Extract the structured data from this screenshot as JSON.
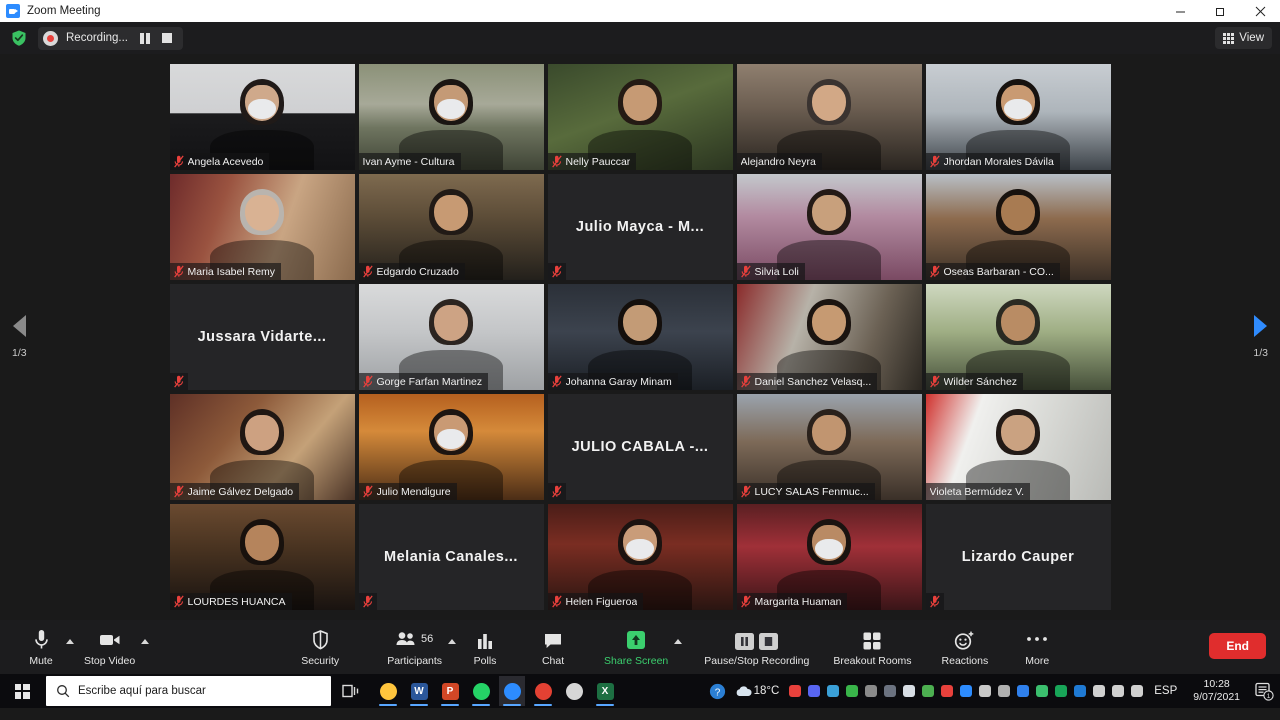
{
  "window": {
    "title": "Zoom Meeting",
    "app_icon": "zoom-icon",
    "minimize_label": "Minimize",
    "maximize_label": "Restore",
    "close_label": "Close"
  },
  "zoom_header": {
    "security_badge_icon": "shield-check-icon",
    "recording_label": "Recording...",
    "record_dot_icon": "record-dot-icon",
    "pause_icon": "pause-icon",
    "stop_icon": "stop-icon",
    "view_label": "View",
    "view_icon": "grid-view-icon"
  },
  "gallery": {
    "page_left_label": "1/3",
    "page_right_label": "1/3",
    "prev_icon": "chevron-left-icon",
    "next_icon": "chevron-right-icon",
    "mic_off_icon": "mic-muted-icon",
    "participants": [
      {
        "name": "Angela Acevedo",
        "muted": true,
        "speaking": false,
        "video": true,
        "display": "bar",
        "skin": "p1"
      },
      {
        "name": "Ivan Ayme - Cultura",
        "muted": false,
        "speaking": true,
        "video": true,
        "display": "bar",
        "skin": "p2"
      },
      {
        "name": "Nelly Pauccar",
        "muted": true,
        "speaking": false,
        "video": true,
        "display": "bar",
        "skin": "p3"
      },
      {
        "name": "Alejandro Neyra",
        "muted": false,
        "speaking": false,
        "video": true,
        "display": "bar",
        "skin": "p4"
      },
      {
        "name": "Jhordan Morales Dávila",
        "muted": true,
        "speaking": false,
        "video": true,
        "display": "bar",
        "skin": "p5"
      },
      {
        "name": "Maria Isabel Remy",
        "muted": true,
        "speaking": false,
        "video": true,
        "display": "bar",
        "skin": "p6"
      },
      {
        "name": "Edgardo Cruzado",
        "muted": true,
        "speaking": false,
        "video": true,
        "display": "bar",
        "skin": "p7"
      },
      {
        "name": "Julio Mayca - M...",
        "muted": true,
        "speaking": false,
        "video": false,
        "display": "center",
        "skin": "off"
      },
      {
        "name": "Silvia Loli",
        "muted": true,
        "speaking": false,
        "video": true,
        "display": "bar",
        "skin": "p8"
      },
      {
        "name": "Oseas Barbaran - CO...",
        "muted": true,
        "speaking": false,
        "video": true,
        "display": "bar",
        "skin": "p9"
      },
      {
        "name": "Jussara Vidarte...",
        "muted": true,
        "speaking": false,
        "video": false,
        "display": "center",
        "skin": "off"
      },
      {
        "name": "Gorge Farfan Martinez",
        "muted": true,
        "speaking": false,
        "video": true,
        "display": "bar",
        "skin": "p10"
      },
      {
        "name": "Johanna Garay Minam",
        "muted": true,
        "speaking": false,
        "video": true,
        "display": "bar",
        "skin": "p11"
      },
      {
        "name": "Daniel Sanchez Velasq...",
        "muted": true,
        "speaking": false,
        "video": true,
        "display": "bar",
        "skin": "p12"
      },
      {
        "name": "Wilder Sánchez",
        "muted": true,
        "speaking": false,
        "video": true,
        "display": "bar",
        "skin": "p13"
      },
      {
        "name": "Jaime Gálvez Delgado",
        "muted": true,
        "speaking": false,
        "video": true,
        "display": "bar",
        "skin": "p14"
      },
      {
        "name": "Julio Mendigure",
        "muted": true,
        "speaking": false,
        "video": true,
        "display": "bar",
        "skin": "p15"
      },
      {
        "name": "JULIO CABALA -...",
        "muted": true,
        "speaking": false,
        "video": false,
        "display": "center",
        "skin": "off"
      },
      {
        "name": "LUCY SALAS Fenmuc...",
        "muted": true,
        "speaking": false,
        "video": true,
        "display": "bar",
        "skin": "p16"
      },
      {
        "name": "Violeta Bermúdez V.",
        "muted": false,
        "speaking": false,
        "video": true,
        "display": "bar",
        "skin": "p17"
      },
      {
        "name": "LOURDES HUANCA",
        "muted": true,
        "speaking": false,
        "video": true,
        "display": "bar",
        "skin": "p18"
      },
      {
        "name": "Melania Canales...",
        "muted": true,
        "speaking": false,
        "video": false,
        "display": "center",
        "skin": "off"
      },
      {
        "name": "Helen Figueroa",
        "muted": true,
        "speaking": false,
        "video": true,
        "display": "bar",
        "skin": "p19"
      },
      {
        "name": "Margarita Huaman",
        "muted": true,
        "speaking": false,
        "video": true,
        "display": "bar",
        "skin": "p20"
      },
      {
        "name": "Lizardo Cauper",
        "muted": true,
        "speaking": false,
        "video": false,
        "display": "center",
        "skin": "off"
      }
    ]
  },
  "toolbar": {
    "mute_label": "Mute",
    "mute_icon": "microphone-icon",
    "mute_caret_icon": "chevron-up-icon",
    "video_label": "Stop Video",
    "video_icon": "video-camera-icon",
    "video_caret_icon": "chevron-up-icon",
    "security_label": "Security",
    "security_icon": "shield-icon",
    "participants_label": "Participants",
    "participants_icon": "people-icon",
    "participants_count": "56",
    "participants_caret_icon": "chevron-up-icon",
    "polls_label": "Polls",
    "polls_icon": "bar-chart-icon",
    "chat_label": "Chat",
    "chat_icon": "chat-bubble-icon",
    "share_label": "Share Screen",
    "share_icon": "share-screen-icon",
    "share_caret_icon": "chevron-up-icon",
    "recording_label": "Pause/Stop Recording",
    "recording_pause_icon": "pause-icon",
    "recording_stop_icon": "stop-icon",
    "breakout_label": "Breakout Rooms",
    "breakout_icon": "breakout-rooms-icon",
    "reactions_label": "Reactions",
    "reactions_icon": "smiley-plus-icon",
    "more_label": "More",
    "more_icon": "ellipsis-icon",
    "end_label": "End"
  },
  "taskbar": {
    "start_icon": "windows-start-icon",
    "search_placeholder": "Escribe aquí para buscar",
    "search_icon": "search-icon",
    "task_view_icon": "task-view-icon",
    "pinned": [
      {
        "name": "file-explorer-icon",
        "glyph": "",
        "color": "#ffc53d",
        "running": true
      },
      {
        "name": "word-icon",
        "glyph": "W",
        "color": "#2b579a",
        "running": true
      },
      {
        "name": "powerpoint-icon",
        "glyph": "P",
        "color": "#d24726",
        "running": true
      },
      {
        "name": "whatsapp-icon",
        "glyph": "",
        "color": "#25d366",
        "running": true
      },
      {
        "name": "zoom-icon",
        "glyph": "",
        "color": "#2d8cff",
        "running": true,
        "active": true
      },
      {
        "name": "chrome-icon",
        "glyph": "",
        "color": "#e34133",
        "running": true
      },
      {
        "name": "settings-icon",
        "glyph": "",
        "color": "#d6d6d6",
        "running": false
      },
      {
        "name": "excel-icon",
        "glyph": "X",
        "color": "#1d6f42",
        "running": true
      }
    ],
    "tray": {
      "help_icon": "help-circle-icon",
      "weather_icon": "cloud-icon",
      "temperature": "18°C",
      "icons": [
        "adobe-icon",
        "discord-icon",
        "driver-icon",
        "earth-icon",
        "antenna-icon",
        "lock-icon",
        "onedrive-icon",
        "leaf-icon",
        "audio-icon",
        "zoom-tray-icon",
        "mic-icon",
        "sound-mixer-icon",
        "bluetooth-icon",
        "evernote-icon",
        "shield-icon",
        "edge-icon",
        "wifi-icon",
        "battery-icon",
        "volume-icon"
      ],
      "language": "ESP",
      "time": "10:28",
      "date": "9/07/2021",
      "notifications_icon": "notifications-icon",
      "notifications_count": "1"
    }
  }
}
